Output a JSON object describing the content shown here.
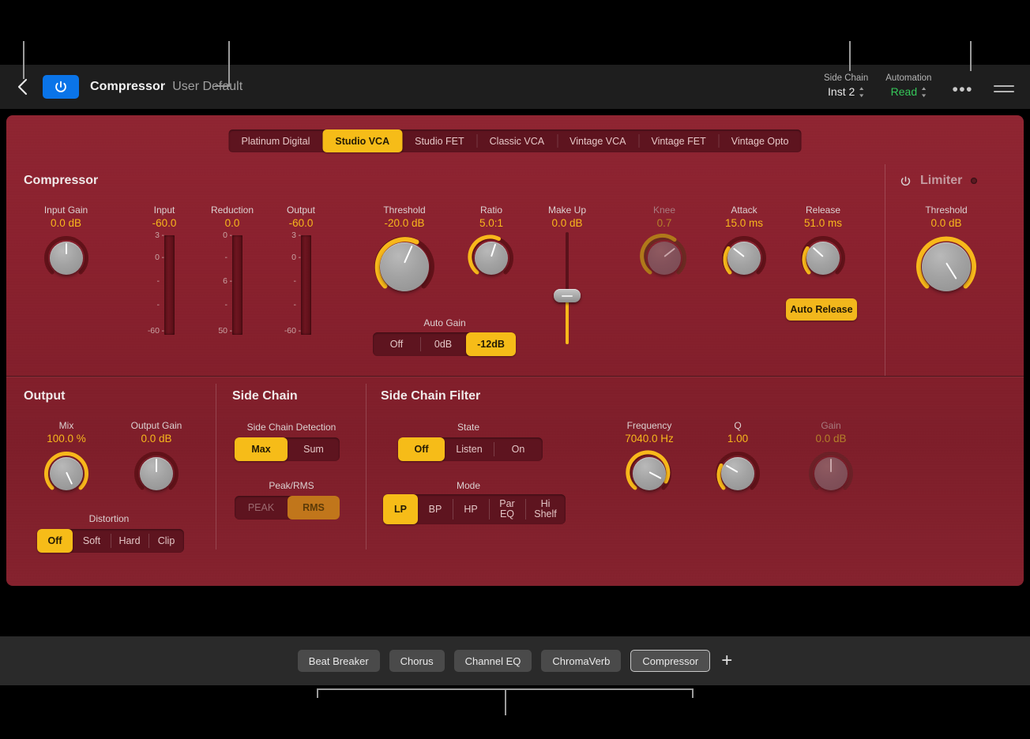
{
  "header": {
    "back_icon": "chevron-left-icon",
    "power_icon": "power-icon",
    "plugin_name": "Compressor",
    "preset_name": "User Default",
    "side_chain_label": "Side Chain",
    "side_chain_value": "Inst 2",
    "automation_label": "Automation",
    "automation_value": "Read",
    "automation_color": "#35c759",
    "more_label": "•••",
    "menu_icon": "hamburger-icon"
  },
  "model_tabs": [
    {
      "label": "Platinum Digital",
      "active": false
    },
    {
      "label": "Studio VCA",
      "active": true
    },
    {
      "label": "Studio FET",
      "active": false
    },
    {
      "label": "Classic VCA",
      "active": false
    },
    {
      "label": "Vintage VCA",
      "active": false
    },
    {
      "label": "Vintage FET",
      "active": false
    },
    {
      "label": "Vintage Opto",
      "active": false
    }
  ],
  "compressor": {
    "title": "Compressor",
    "input_gain": {
      "label": "Input Gain",
      "value": "0.0 dB"
    },
    "threshold": {
      "label": "Threshold",
      "value": "-20.0 dB"
    },
    "ratio": {
      "label": "Ratio",
      "value": "5.0:1"
    },
    "make_up": {
      "label": "Make Up",
      "value": "0.0 dB"
    },
    "knee": {
      "label": "Knee",
      "value": "0.7"
    },
    "attack": {
      "label": "Attack",
      "value": "15.0 ms"
    },
    "release": {
      "label": "Release",
      "value": "51.0 ms"
    },
    "auto_release_label": "Auto Release",
    "auto_gain": {
      "label": "Auto Gain",
      "options": [
        {
          "label": "Off",
          "on": false
        },
        {
          "label": "0dB",
          "on": false
        },
        {
          "label": "-12dB",
          "on": true
        }
      ]
    }
  },
  "meters": [
    {
      "label": "Input",
      "value": "-60.0",
      "scale": [
        "3",
        "0",
        "-",
        "-",
        "-60"
      ]
    },
    {
      "label": "Reduction",
      "value": "0.0",
      "scale": [
        "0",
        "-",
        "6",
        "-",
        "50"
      ]
    },
    {
      "label": "Output",
      "value": "-60.0",
      "scale": [
        "3",
        "0",
        "-",
        "-",
        "-60"
      ]
    }
  ],
  "limiter": {
    "power_icon": "power-icon",
    "title": "Limiter",
    "led": "led-indicator",
    "threshold": {
      "label": "Threshold",
      "value": "0.0 dB"
    }
  },
  "output": {
    "title": "Output",
    "mix": {
      "label": "Mix",
      "value": "100.0 %"
    },
    "output_gain": {
      "label": "Output Gain",
      "value": "0.0 dB"
    },
    "distortion": {
      "label": "Distortion",
      "options": [
        {
          "label": "Off",
          "on": true
        },
        {
          "label": "Soft",
          "on": false
        },
        {
          "label": "Hard",
          "on": false
        },
        {
          "label": "Clip",
          "on": false
        }
      ]
    }
  },
  "side_chain": {
    "title": "Side Chain",
    "detection": {
      "label": "Side Chain Detection",
      "options": [
        {
          "label": "Max",
          "on": true
        },
        {
          "label": "Sum",
          "on": false
        }
      ]
    },
    "peak_rms": {
      "label": "Peak/RMS",
      "options": [
        {
          "label": "PEAK",
          "on": false
        },
        {
          "label": "RMS",
          "on": true
        }
      ]
    }
  },
  "side_chain_filter": {
    "title": "Side Chain Filter",
    "state": {
      "label": "State",
      "options": [
        {
          "label": "Off",
          "on": true
        },
        {
          "label": "Listen",
          "on": false
        },
        {
          "label": "On",
          "on": false
        }
      ]
    },
    "mode": {
      "label": "Mode",
      "options": [
        {
          "label": "LP",
          "on": true
        },
        {
          "label": "BP",
          "on": false
        },
        {
          "label": "HP",
          "on": false
        },
        {
          "label": "Par\nEQ",
          "on": false
        },
        {
          "label": "Hi\nShelf",
          "on": false
        }
      ]
    },
    "frequency": {
      "label": "Frequency",
      "value": "7040.0 Hz"
    },
    "q": {
      "label": "Q",
      "value": "1.00"
    },
    "gain": {
      "label": "Gain",
      "value": "0.0 dB"
    }
  },
  "chain": {
    "plugins": [
      {
        "label": "Beat Breaker",
        "selected": false
      },
      {
        "label": "Chorus",
        "selected": false
      },
      {
        "label": "Channel EQ",
        "selected": false
      },
      {
        "label": "ChromaVerb",
        "selected": false
      },
      {
        "label": "Compressor",
        "selected": true
      }
    ],
    "add_label": "+"
  },
  "colors": {
    "accent_yellow": "#f6bc18",
    "panel_red": "#8a1f2c",
    "automation_green": "#35c759",
    "power_blue": "#0a74e8"
  }
}
